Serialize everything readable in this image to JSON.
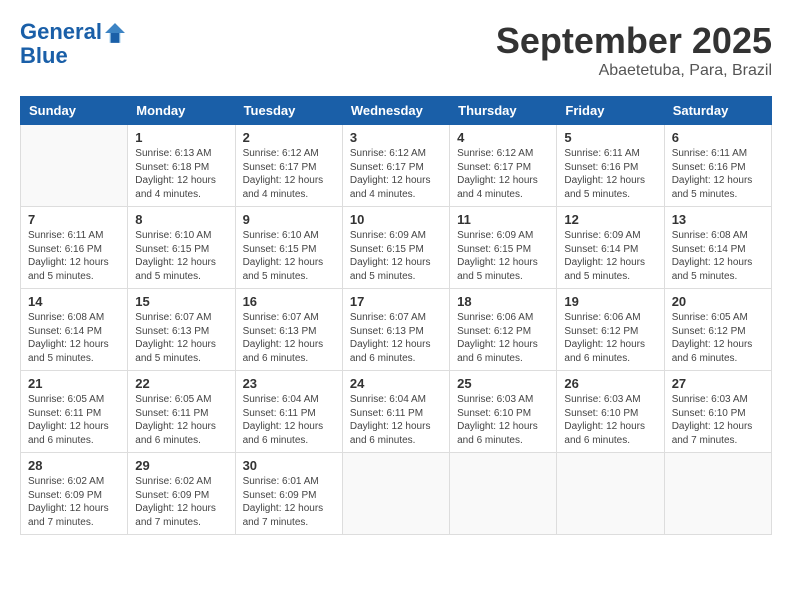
{
  "header": {
    "logo_line1": "General",
    "logo_line2": "Blue",
    "month": "September 2025",
    "location": "Abaetetuba, Para, Brazil"
  },
  "days_of_week": [
    "Sunday",
    "Monday",
    "Tuesday",
    "Wednesday",
    "Thursday",
    "Friday",
    "Saturday"
  ],
  "weeks": [
    [
      {
        "day": "",
        "info": ""
      },
      {
        "day": "1",
        "info": "Sunrise: 6:13 AM\nSunset: 6:18 PM\nDaylight: 12 hours\nand 4 minutes."
      },
      {
        "day": "2",
        "info": "Sunrise: 6:12 AM\nSunset: 6:17 PM\nDaylight: 12 hours\nand 4 minutes."
      },
      {
        "day": "3",
        "info": "Sunrise: 6:12 AM\nSunset: 6:17 PM\nDaylight: 12 hours\nand 4 minutes."
      },
      {
        "day": "4",
        "info": "Sunrise: 6:12 AM\nSunset: 6:17 PM\nDaylight: 12 hours\nand 4 minutes."
      },
      {
        "day": "5",
        "info": "Sunrise: 6:11 AM\nSunset: 6:16 PM\nDaylight: 12 hours\nand 5 minutes."
      },
      {
        "day": "6",
        "info": "Sunrise: 6:11 AM\nSunset: 6:16 PM\nDaylight: 12 hours\nand 5 minutes."
      }
    ],
    [
      {
        "day": "7",
        "info": "Sunrise: 6:11 AM\nSunset: 6:16 PM\nDaylight: 12 hours\nand 5 minutes."
      },
      {
        "day": "8",
        "info": "Sunrise: 6:10 AM\nSunset: 6:15 PM\nDaylight: 12 hours\nand 5 minutes."
      },
      {
        "day": "9",
        "info": "Sunrise: 6:10 AM\nSunset: 6:15 PM\nDaylight: 12 hours\nand 5 minutes."
      },
      {
        "day": "10",
        "info": "Sunrise: 6:09 AM\nSunset: 6:15 PM\nDaylight: 12 hours\nand 5 minutes."
      },
      {
        "day": "11",
        "info": "Sunrise: 6:09 AM\nSunset: 6:15 PM\nDaylight: 12 hours\nand 5 minutes."
      },
      {
        "day": "12",
        "info": "Sunrise: 6:09 AM\nSunset: 6:14 PM\nDaylight: 12 hours\nand 5 minutes."
      },
      {
        "day": "13",
        "info": "Sunrise: 6:08 AM\nSunset: 6:14 PM\nDaylight: 12 hours\nand 5 minutes."
      }
    ],
    [
      {
        "day": "14",
        "info": "Sunrise: 6:08 AM\nSunset: 6:14 PM\nDaylight: 12 hours\nand 5 minutes."
      },
      {
        "day": "15",
        "info": "Sunrise: 6:07 AM\nSunset: 6:13 PM\nDaylight: 12 hours\nand 5 minutes."
      },
      {
        "day": "16",
        "info": "Sunrise: 6:07 AM\nSunset: 6:13 PM\nDaylight: 12 hours\nand 6 minutes."
      },
      {
        "day": "17",
        "info": "Sunrise: 6:07 AM\nSunset: 6:13 PM\nDaylight: 12 hours\nand 6 minutes."
      },
      {
        "day": "18",
        "info": "Sunrise: 6:06 AM\nSunset: 6:12 PM\nDaylight: 12 hours\nand 6 minutes."
      },
      {
        "day": "19",
        "info": "Sunrise: 6:06 AM\nSunset: 6:12 PM\nDaylight: 12 hours\nand 6 minutes."
      },
      {
        "day": "20",
        "info": "Sunrise: 6:05 AM\nSunset: 6:12 PM\nDaylight: 12 hours\nand 6 minutes."
      }
    ],
    [
      {
        "day": "21",
        "info": "Sunrise: 6:05 AM\nSunset: 6:11 PM\nDaylight: 12 hours\nand 6 minutes."
      },
      {
        "day": "22",
        "info": "Sunrise: 6:05 AM\nSunset: 6:11 PM\nDaylight: 12 hours\nand 6 minutes."
      },
      {
        "day": "23",
        "info": "Sunrise: 6:04 AM\nSunset: 6:11 PM\nDaylight: 12 hours\nand 6 minutes."
      },
      {
        "day": "24",
        "info": "Sunrise: 6:04 AM\nSunset: 6:11 PM\nDaylight: 12 hours\nand 6 minutes."
      },
      {
        "day": "25",
        "info": "Sunrise: 6:03 AM\nSunset: 6:10 PM\nDaylight: 12 hours\nand 6 minutes."
      },
      {
        "day": "26",
        "info": "Sunrise: 6:03 AM\nSunset: 6:10 PM\nDaylight: 12 hours\nand 6 minutes."
      },
      {
        "day": "27",
        "info": "Sunrise: 6:03 AM\nSunset: 6:10 PM\nDaylight: 12 hours\nand 7 minutes."
      }
    ],
    [
      {
        "day": "28",
        "info": "Sunrise: 6:02 AM\nSunset: 6:09 PM\nDaylight: 12 hours\nand 7 minutes."
      },
      {
        "day": "29",
        "info": "Sunrise: 6:02 AM\nSunset: 6:09 PM\nDaylight: 12 hours\nand 7 minutes."
      },
      {
        "day": "30",
        "info": "Sunrise: 6:01 AM\nSunset: 6:09 PM\nDaylight: 12 hours\nand 7 minutes."
      },
      {
        "day": "",
        "info": ""
      },
      {
        "day": "",
        "info": ""
      },
      {
        "day": "",
        "info": ""
      },
      {
        "day": "",
        "info": ""
      }
    ]
  ]
}
